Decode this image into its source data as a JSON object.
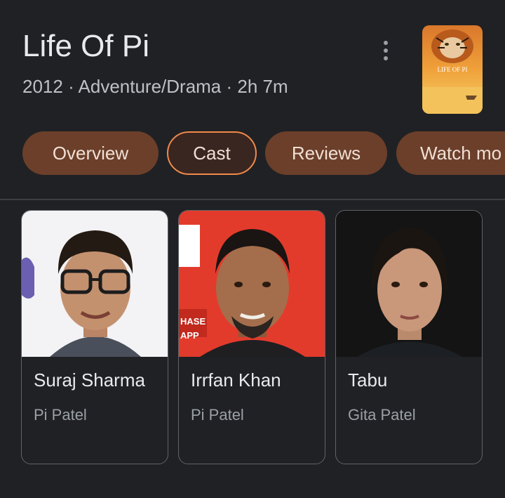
{
  "movie": {
    "title": "Life Of Pi",
    "subtitle": "2012 · Adventure/Drama · 2h 7m",
    "poster_text": "LIFE OF PI"
  },
  "tabs": [
    {
      "label": "Overview",
      "active": false
    },
    {
      "label": "Cast",
      "active": true
    },
    {
      "label": "Reviews",
      "active": false
    },
    {
      "label": "Watch mo",
      "active": false
    }
  ],
  "cast": [
    {
      "name": "Suraj Sharma",
      "role": "Pi Patel"
    },
    {
      "name": "Irrfan Khan",
      "role": "Pi Patel"
    },
    {
      "name": "Tabu",
      "role": "Gita Patel"
    }
  ],
  "colors": {
    "background": "#202124",
    "chip": "#6b3f2a",
    "chip_active_border": "#f08a4b"
  }
}
